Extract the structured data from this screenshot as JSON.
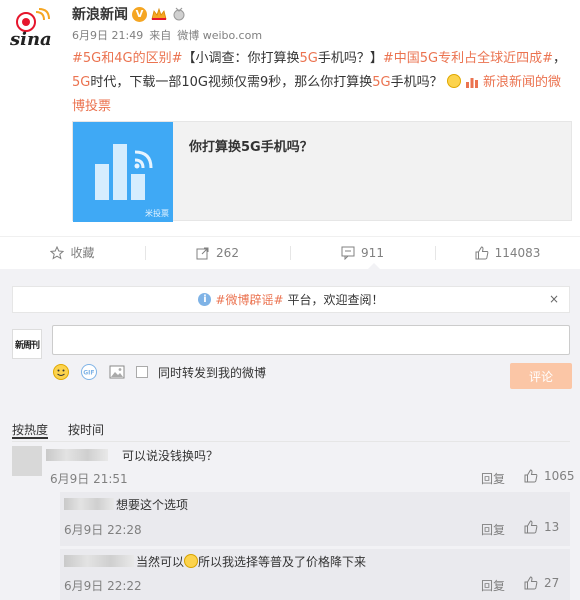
{
  "post": {
    "author": "新浪新闻",
    "vip_badge": "V",
    "date": "6月9日 21:49",
    "source_prefix": "来自",
    "source": "微博 weibo.com",
    "text": {
      "tag1": "#5G和4G的区别#",
      "survey": "【小调查：你打算换",
      "survey_5g": "5G",
      "survey_end": "手机吗？】",
      "tag2": "#中国5G专利占全球近四成#",
      "sep": "，",
      "body_5g": "5G",
      "body": "时代，下载一部10G视频仅需9秒，那么你打算换",
      "body_5g2": "5G",
      "body_end": "手机吗？",
      "vote_link": "新浪新闻的微博投票"
    },
    "vote_card": {
      "title": "你打算换5G手机吗？",
      "brand": "米投票"
    }
  },
  "actions": {
    "favorite": "收藏",
    "forward": "262",
    "comment": "911",
    "like": "114083"
  },
  "comments_area": {
    "notice_tag": "#微博辟谣#",
    "notice_text": "平台，欢迎查阅！",
    "close": "×",
    "my_avatar_text": "新周刊",
    "tools_repost": "同时转发到我的微博",
    "submit": "评论",
    "sort_hot": "按热度",
    "sort_time": "按时间"
  },
  "comments": [
    {
      "text": "可以说没钱换吗？",
      "time": "6月9日 21:51",
      "reply": "回复",
      "likes": "1065"
    },
    {
      "text": "想要这个选项",
      "time": "6月9日 22:28",
      "reply": "回复",
      "likes": "13"
    },
    {
      "text_a": "当然可以",
      "text_b": "所以我选择等普及了价格降下来",
      "time": "6月9日 22:22",
      "reply": "回复",
      "likes": "27"
    }
  ],
  "colors": {
    "accent": "#eb7350",
    "blue": "#3fa9f5",
    "submit_disabled": "#fbc6a6"
  }
}
